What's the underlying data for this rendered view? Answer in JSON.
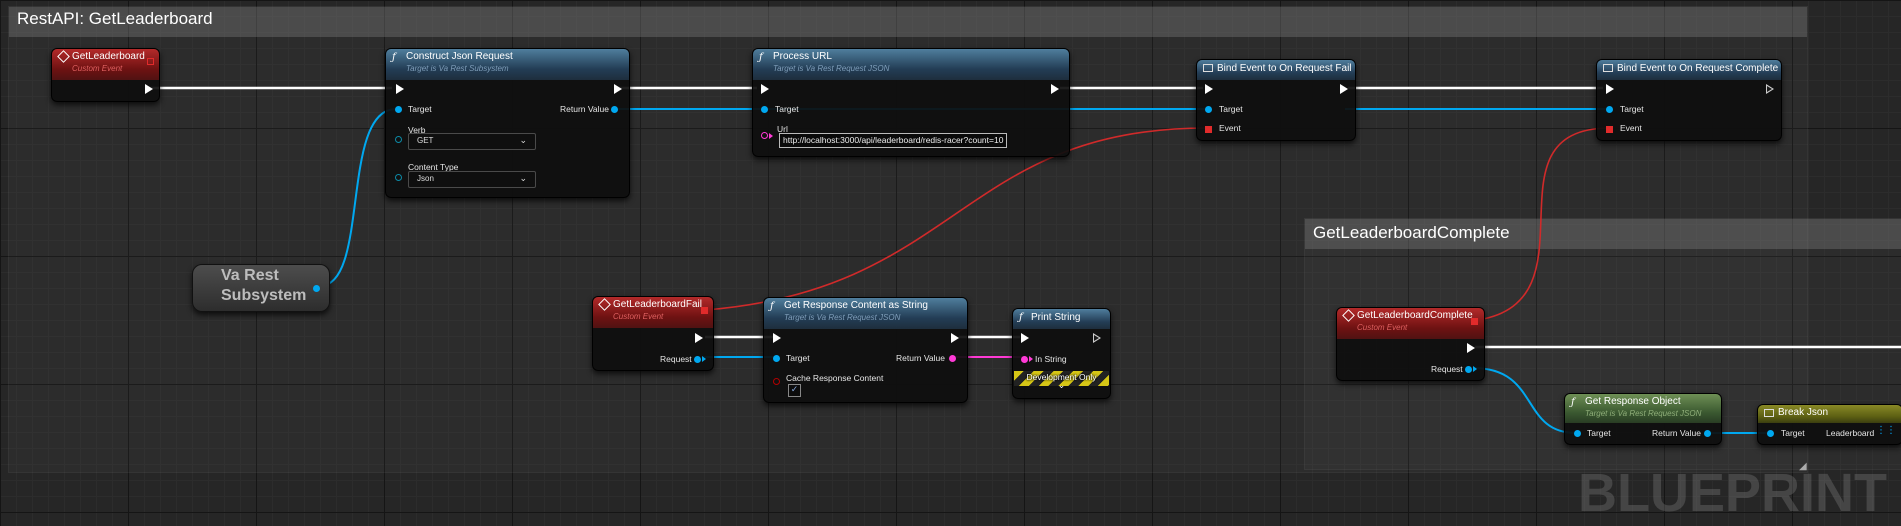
{
  "comments": {
    "main_title": "RestAPI: GetLeaderboard",
    "complete_title": "GetLeaderboardComplete"
  },
  "nodes": {
    "get_leaderboard": {
      "title": "GetLeaderboard",
      "subtitle": "Custom Event"
    },
    "construct_json": {
      "title": "Construct Json Request",
      "subtitle": "Target is Va Rest Subsystem",
      "target_label": "Target",
      "return_label": "Return Value",
      "verb_label": "Verb",
      "verb_value": "GET",
      "content_type_label": "Content Type",
      "content_type_value": "Json"
    },
    "process_url": {
      "title": "Process URL",
      "subtitle": "Target is Va Rest Request JSON",
      "target_label": "Target",
      "url_label": "Url",
      "url_value": "http://localhost:3000/api/leaderboard/redis-racer?count=10"
    },
    "bind_fail": {
      "title": "Bind Event to On Request Fail",
      "target_label": "Target",
      "event_label": "Event"
    },
    "bind_complete": {
      "title": "Bind Event to On Request Complete",
      "target_label": "Target",
      "event_label": "Event"
    },
    "va_rest_subsystem": {
      "line1": "Va Rest",
      "line2": "Subsystem"
    },
    "get_leaderboard_fail": {
      "title": "GetLeaderboardFail",
      "subtitle": "Custom Event",
      "request_label": "Request"
    },
    "get_response_content": {
      "title": "Get Response Content as String",
      "subtitle": "Target is Va Rest Request JSON",
      "target_label": "Target",
      "return_label": "Return Value",
      "cache_label": "Cache Response Content",
      "cache_checked": "✓"
    },
    "print_string": {
      "title": "Print String",
      "in_string_label": "In String",
      "dev_only_label": "Development Only"
    },
    "get_leaderboard_complete": {
      "title": "GetLeaderboardComplete",
      "subtitle": "Custom Event",
      "request_label": "Request"
    },
    "get_response_object": {
      "title": "Get Response Object",
      "subtitle": "Target is Va Rest Request JSON",
      "target_label": "Target",
      "return_label": "Return Value"
    },
    "break_json": {
      "title": "Break Json",
      "target_label": "Target",
      "leaderboard_label": "Leaderboard"
    }
  },
  "watermark": "BLUEPRINT",
  "colors": {
    "exec_wire": "#ffffff",
    "object_wire": "#00a8f0",
    "delegate_wire": "#d02a2a",
    "string_wire": "#ff3ad6",
    "function_header": "#233d55",
    "event_header": "#6e1212",
    "pure_header": "#3a5830",
    "struct_header": "#5c5f13"
  },
  "icons": {
    "function": "function-f-icon",
    "event": "event-diamond-icon",
    "bind": "bind-box-icon",
    "exec": "exec-triangle-icon",
    "delegate": "delegate-square-icon"
  }
}
